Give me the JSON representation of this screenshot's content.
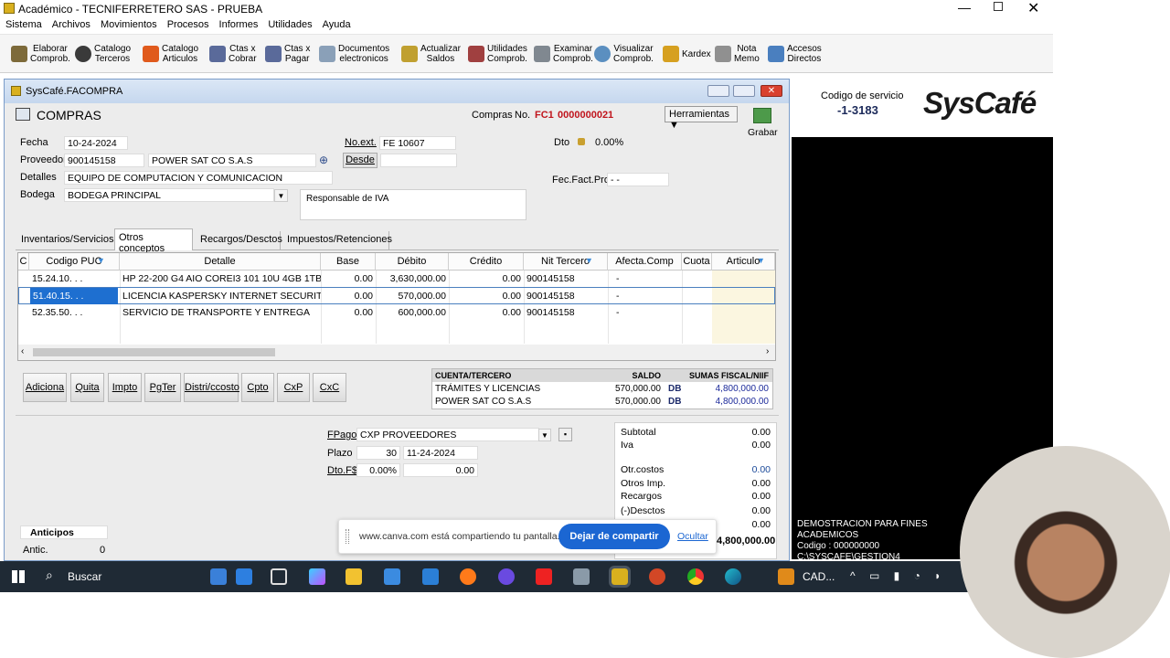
{
  "app": {
    "title": "Académico - TECNIFERRETERO SAS - PRUEBA"
  },
  "menu": [
    "Sistema",
    "Archivos",
    "Movimientos",
    "Procesos",
    "Informes",
    "Utilidades",
    "Ayuda"
  ],
  "toolbar": [
    {
      "l1": "Elaborar",
      "l2": "Comprob.",
      "icon": "pencil-icon",
      "color": "#7d6a3a"
    },
    {
      "l1": "Catalogo",
      "l2": "Terceros",
      "icon": "user-icon",
      "color": "#3a3a3a"
    },
    {
      "l1": "Catalogo",
      "l2": "Articulos",
      "icon": "box-icon",
      "color": "#e05a1c"
    },
    {
      "l1": "Ctas x",
      "l2": "Cobrar",
      "icon": "receivable-icon",
      "color": "#5a6a9a"
    },
    {
      "l1": "Ctas x",
      "l2": "Pagar",
      "icon": "payable-icon",
      "color": "#5a6a9a"
    },
    {
      "l1": "Documentos",
      "l2": "electronicos",
      "icon": "documents-icon",
      "color": "#8aa0b8"
    },
    {
      "l1": "Actualizar",
      "l2": "Saldos",
      "icon": "refresh-icon",
      "color": "#c0a030"
    },
    {
      "l1": "Utilidades",
      "l2": "Comprob.",
      "icon": "tools-icon",
      "color": "#a04040"
    },
    {
      "l1": "Examinar",
      "l2": "Comprob.",
      "icon": "examine-icon",
      "color": "#808890"
    },
    {
      "l1": "Visualizar",
      "l2": "Comprob.",
      "icon": "view-icon",
      "color": "#5b8fc0"
    },
    {
      "l1": "Kardex",
      "l2": "",
      "icon": "kardex-icon",
      "color": "#d6a020"
    },
    {
      "l1": "Nota",
      "l2": "Memo",
      "icon": "note-icon",
      "color": "#909090"
    },
    {
      "l1": "Accesos",
      "l2": "Directos",
      "icon": "folder-icon",
      "color": "#4a7fbf"
    }
  ],
  "service": {
    "label": "Codigo de servicio",
    "code": "-1-3183",
    "brand": "SysCafé"
  },
  "demo": [
    "DEMOSTRACION PARA FINES ACADEMICOS",
    "Codigo : 000000000",
    "C:\\SYSCAFE\\GESTION4"
  ],
  "child": {
    "title": "SysCafé.FACOMPRA",
    "heading": "COMPRAS",
    "compras_label": "Compras",
    "no_label": "No.",
    "doc_type": "FC1",
    "doc_number": "0000000021",
    "tools_label": "Herramientas",
    "save_label": "Grabar",
    "fecha_label": "Fecha",
    "fecha": "10-24-2024",
    "proveedor_label": "Proveedor",
    "proveedor_nit": "900145158",
    "proveedor_name": "POWER SAT CO S.A.S",
    "detalles_label": "Detalles",
    "detalles": "EQUIPO DE COMPUTACION Y COMUNICACION",
    "bodega_label": "Bodega",
    "bodega": "BODEGA PRINCIPAL",
    "noext_label": "No.ext.",
    "noext": "FE 10607",
    "desde_label": "Desde",
    "responsable": "Responsable de IVA",
    "dto_label": "Dto",
    "dto": "0.00%",
    "fecfact_label": "Fec.Fact.Pro",
    "fecfact": "-  -"
  },
  "tabs": [
    "Inventarios/Servicios",
    "Otros conceptos",
    "Recargos/Desctos",
    "Impuestos/Retenciones"
  ],
  "grid": {
    "headers": [
      "C",
      "Codigo PUC",
      "Detalle",
      "Base",
      "Débito",
      "Crédito",
      "Nit Tercero",
      "Afecta.Comp",
      "Cuota",
      "Articulo"
    ],
    "rows": [
      [
        "15.24.10.  .  .",
        "HP 22-200 G4 AIO COREI3 101 10U 4GB 1TB PANT",
        "0.00",
        "3,630,000.00",
        "0.00",
        "900145158",
        "-"
      ],
      [
        "51.40.15.  .  .",
        "LICENCIA KASPERSKY INTERNET SECURITY MULT",
        "0.00",
        "570,000.00",
        "0.00",
        "900145158",
        "-"
      ],
      [
        "52.35.50.  .  .",
        "SERVICIO DE TRANSPORTE Y ENTREGA",
        "0.00",
        "600,000.00",
        "0.00",
        "900145158",
        "-"
      ]
    ]
  },
  "buttons": [
    "Adiciona",
    "Quita",
    "Impto",
    "PgTer",
    "Distri/ccosto",
    "Cpto",
    "CxP",
    "CxC"
  ],
  "summary": {
    "headers": [
      "CUENTA/TERCERO",
      "SALDO",
      "SUMAS FISCAL/NIIF"
    ],
    "rows": [
      [
        "TRÁMITES Y LICENCIAS",
        "570,000.00",
        "DB",
        "4,800,000.00"
      ],
      [
        "POWER SAT CO S.A.S",
        "570,000.00",
        "DB",
        "4,800,000.00"
      ]
    ]
  },
  "pago": {
    "fpago_label": "FPago",
    "fpago": "CXP PROVEEDORES",
    "plazo_label": "Plazo",
    "plazo": "30",
    "plazo_fecha": "11-24-2024",
    "dto_label": "Dto.F$",
    "dto_pct": "0.00%",
    "dto_val": "0.00"
  },
  "totals": [
    {
      "label": "Subtotal",
      "value": "0.00"
    },
    {
      "label": "Iva",
      "value": "0.00"
    },
    {
      "label": "Otr.costos",
      "value": "0.00"
    },
    {
      "label": "Otros Imp.",
      "value": "0.00"
    },
    {
      "label": "Recargos",
      "value": "0.00"
    },
    {
      "label": "(-)Desctos",
      "value": "0.00"
    },
    {
      "label": "",
      "value": "0.00"
    }
  ],
  "grand_total": "4,800,000.00",
  "anticipos": {
    "label": "Anticipos",
    "antic_label": "Antic.",
    "antic": "0"
  },
  "share": {
    "text": "www.canva.com está compartiendo tu pantalla.",
    "stop": "Dejar de compartir",
    "hide": "Ocultar"
  },
  "taskbar": {
    "search": "Buscar",
    "cad": "CAD..."
  }
}
